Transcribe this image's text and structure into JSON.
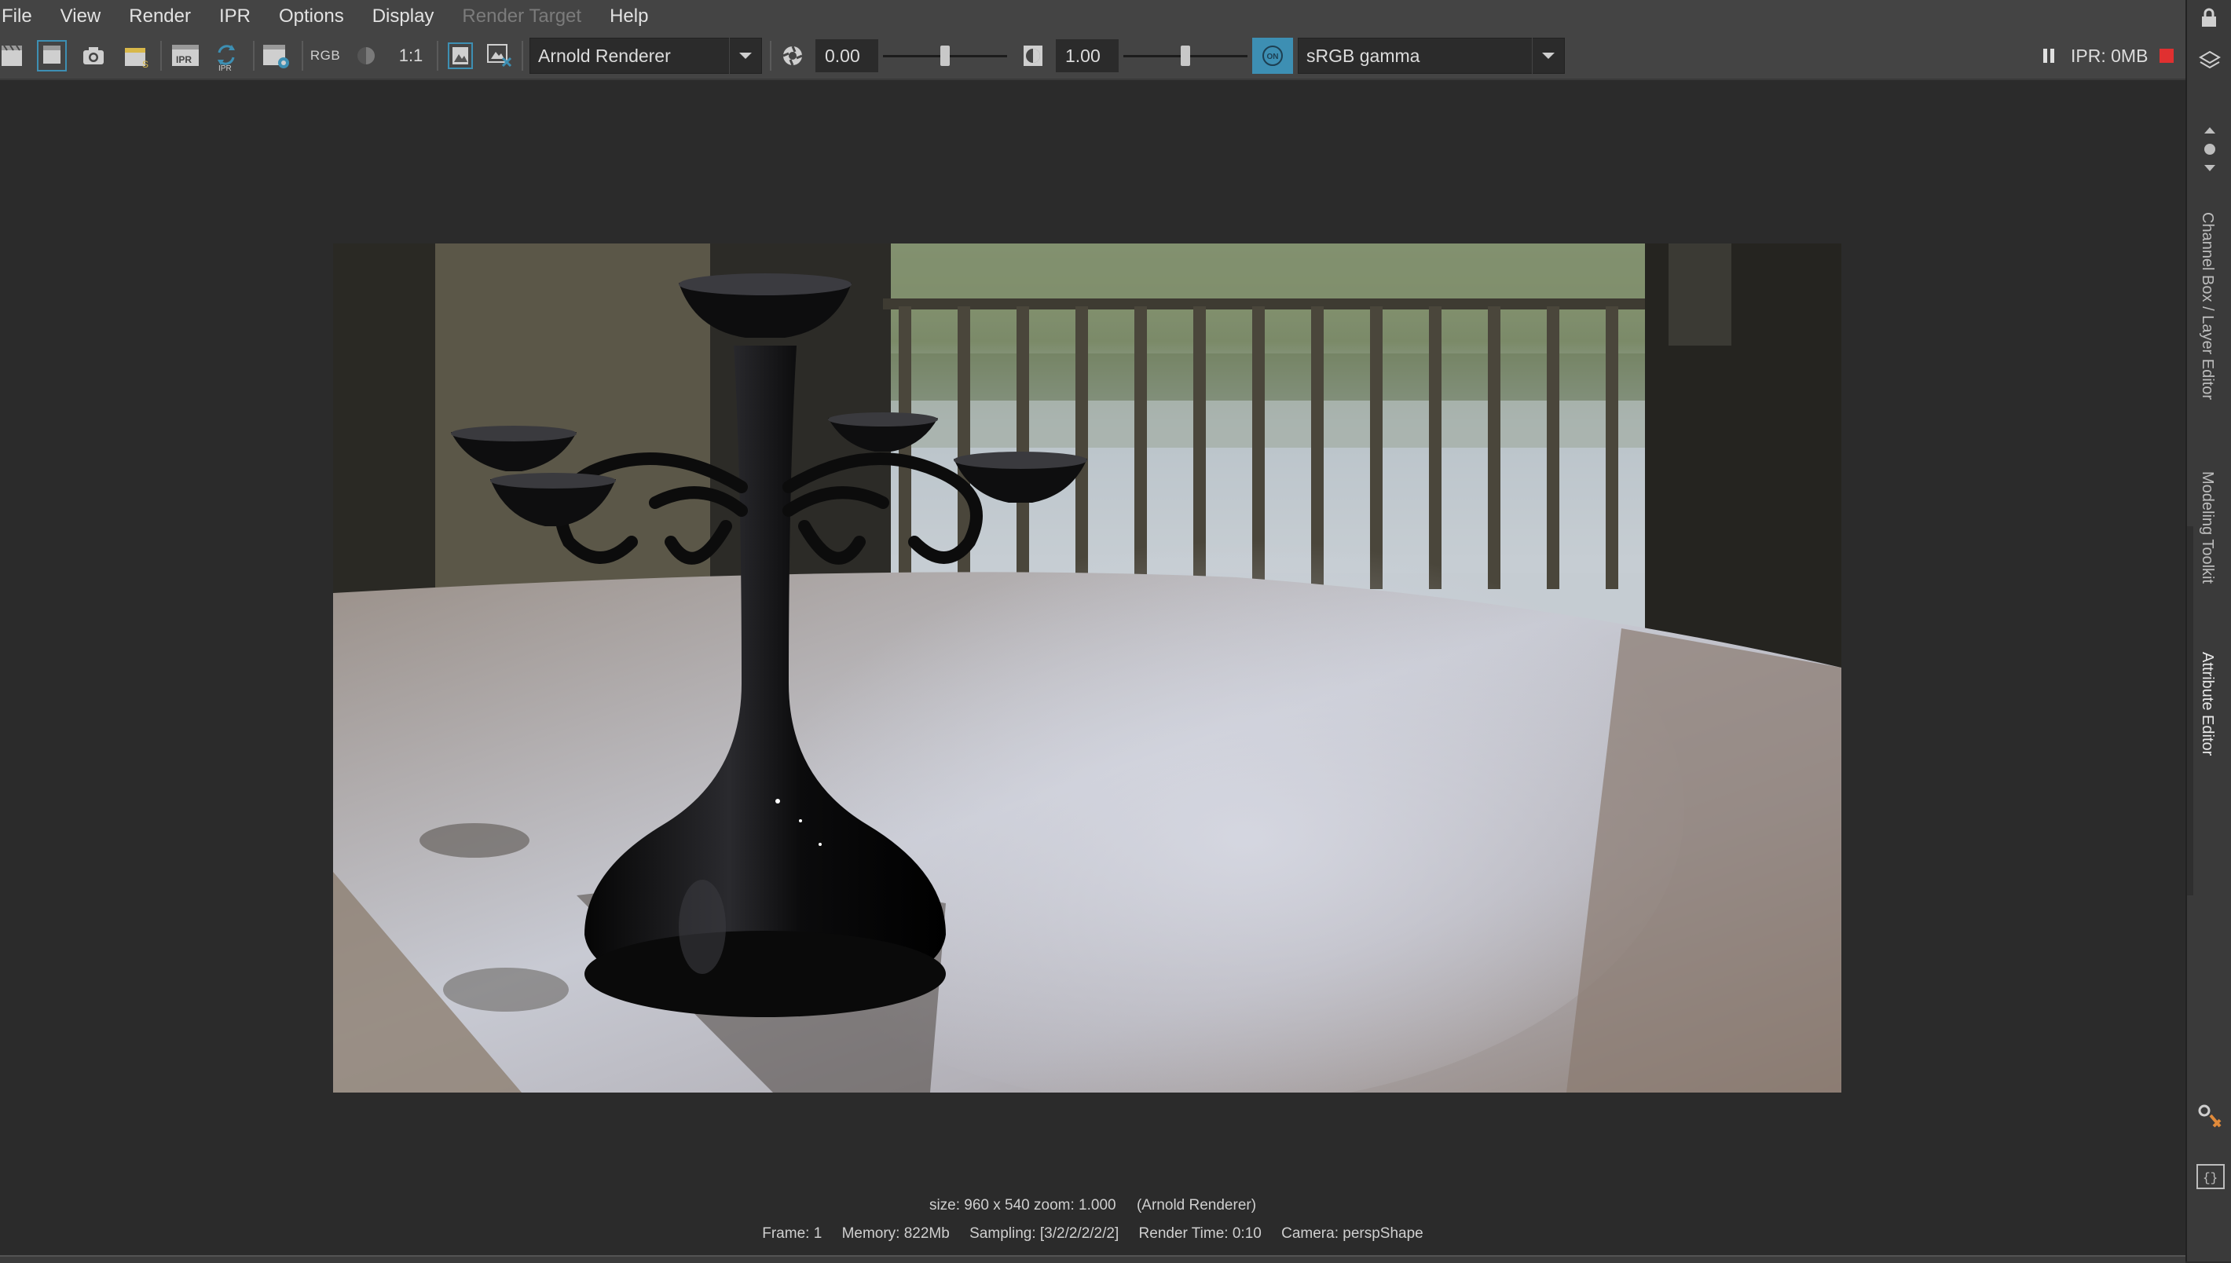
{
  "menu": [
    "File",
    "View",
    "Render",
    "IPR",
    "Options",
    "Display",
    "Render Target",
    "Help"
  ],
  "menu_disabled": [
    "Render Target"
  ],
  "toolbar": {
    "rgb_label": "RGB",
    "ratio_label": "1:1",
    "renderer": "Arnold Renderer",
    "exposure": "0.00",
    "exposure_level": 0.5,
    "gamma": "1.00",
    "gamma_level": 0.5,
    "view_transform_toggle": "ON",
    "color_space": "sRGB gamma",
    "ipr_memory": "IPR: 0MB"
  },
  "colors": {
    "accent": "#3d8fb3",
    "stop": "#e03030",
    "panel": "#444444",
    "background": "#2b2b2b"
  },
  "status": {
    "line1": "size: 960 x 540 zoom: 1.000     (Arnold Renderer)",
    "frame": "Frame: 1",
    "memory": "Memory: 822Mb",
    "sampling": "Sampling: [3/2/2/2/2/2]",
    "render_time": "Render Time: 0:10",
    "camera": "Camera: perspShape"
  },
  "render_image": {
    "subject": "black candelabra on glossy table in front of balcony window"
  }
}
